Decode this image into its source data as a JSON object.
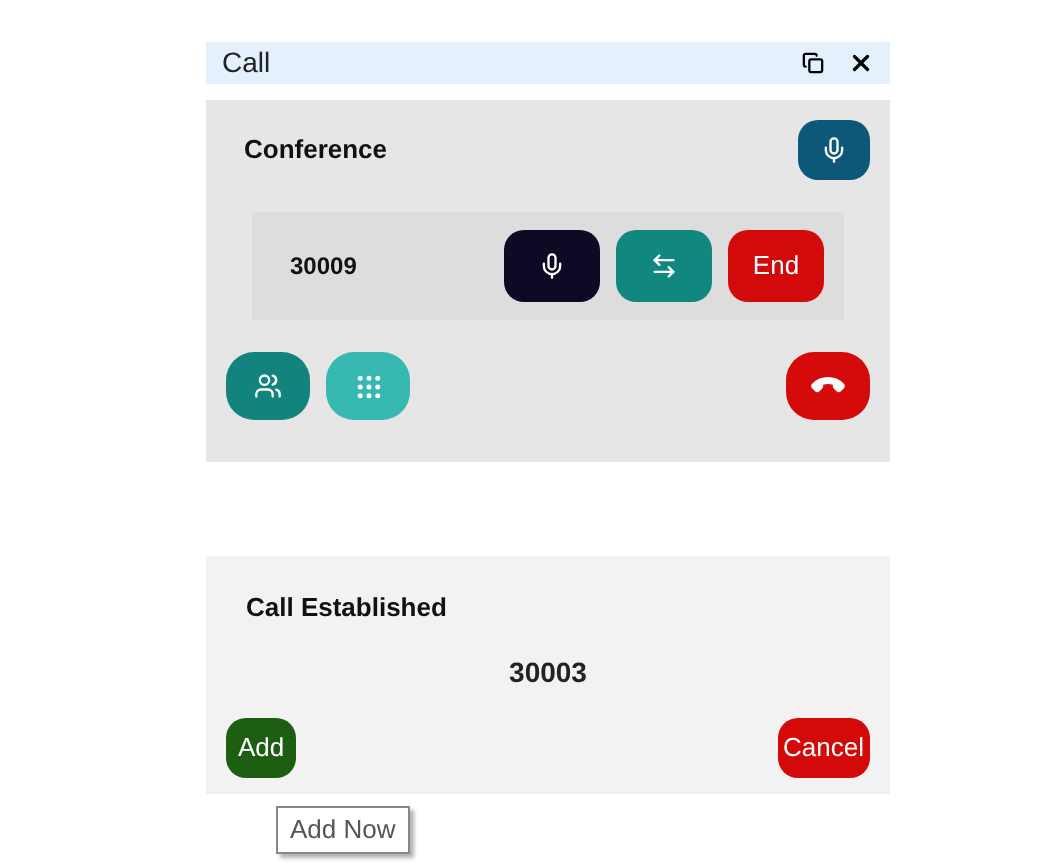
{
  "window": {
    "title": "Call"
  },
  "conference": {
    "title": "Conference",
    "participants": [
      {
        "number": "30009",
        "end_label": "End"
      }
    ]
  },
  "established": {
    "title": "Call Established",
    "number": "30003",
    "add_label": "Add",
    "cancel_label": "Cancel",
    "tooltip": "Add Now"
  }
}
